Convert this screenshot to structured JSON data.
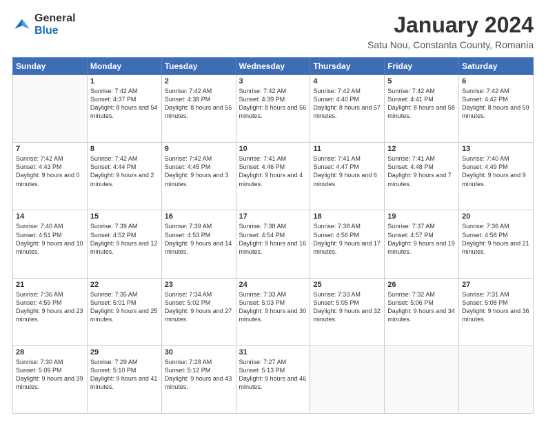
{
  "header": {
    "logo": {
      "general": "General",
      "blue": "Blue"
    },
    "title": "January 2024",
    "location": "Satu Nou, Constanta County, Romania"
  },
  "days_of_week": [
    "Sunday",
    "Monday",
    "Tuesday",
    "Wednesday",
    "Thursday",
    "Friday",
    "Saturday"
  ],
  "weeks": [
    [
      {
        "day": "",
        "text": ""
      },
      {
        "day": "1",
        "text": "Sunrise: 7:42 AM\nSunset: 4:37 PM\nDaylight: 8 hours\nand 54 minutes."
      },
      {
        "day": "2",
        "text": "Sunrise: 7:42 AM\nSunset: 4:38 PM\nDaylight: 8 hours\nand 55 minutes."
      },
      {
        "day": "3",
        "text": "Sunrise: 7:42 AM\nSunset: 4:39 PM\nDaylight: 8 hours\nand 56 minutes."
      },
      {
        "day": "4",
        "text": "Sunrise: 7:42 AM\nSunset: 4:40 PM\nDaylight: 8 hours\nand 57 minutes."
      },
      {
        "day": "5",
        "text": "Sunrise: 7:42 AM\nSunset: 4:41 PM\nDaylight: 8 hours\nand 58 minutes."
      },
      {
        "day": "6",
        "text": "Sunrise: 7:42 AM\nSunset: 4:42 PM\nDaylight: 8 hours\nand 59 minutes."
      }
    ],
    [
      {
        "day": "7",
        "text": "Sunrise: 7:42 AM\nSunset: 4:43 PM\nDaylight: 9 hours\nand 0 minutes."
      },
      {
        "day": "8",
        "text": "Sunrise: 7:42 AM\nSunset: 4:44 PM\nDaylight: 9 hours\nand 2 minutes."
      },
      {
        "day": "9",
        "text": "Sunrise: 7:42 AM\nSunset: 4:45 PM\nDaylight: 9 hours\nand 3 minutes."
      },
      {
        "day": "10",
        "text": "Sunrise: 7:41 AM\nSunset: 4:46 PM\nDaylight: 9 hours\nand 4 minutes."
      },
      {
        "day": "11",
        "text": "Sunrise: 7:41 AM\nSunset: 4:47 PM\nDaylight: 9 hours\nand 6 minutes."
      },
      {
        "day": "12",
        "text": "Sunrise: 7:41 AM\nSunset: 4:48 PM\nDaylight: 9 hours\nand 7 minutes."
      },
      {
        "day": "13",
        "text": "Sunrise: 7:40 AM\nSunset: 4:49 PM\nDaylight: 9 hours\nand 9 minutes."
      }
    ],
    [
      {
        "day": "14",
        "text": "Sunrise: 7:40 AM\nSunset: 4:51 PM\nDaylight: 9 hours\nand 10 minutes."
      },
      {
        "day": "15",
        "text": "Sunrise: 7:39 AM\nSunset: 4:52 PM\nDaylight: 9 hours\nand 12 minutes."
      },
      {
        "day": "16",
        "text": "Sunrise: 7:39 AM\nSunset: 4:53 PM\nDaylight: 9 hours\nand 14 minutes."
      },
      {
        "day": "17",
        "text": "Sunrise: 7:38 AM\nSunset: 4:54 PM\nDaylight: 9 hours\nand 16 minutes."
      },
      {
        "day": "18",
        "text": "Sunrise: 7:38 AM\nSunset: 4:56 PM\nDaylight: 9 hours\nand 17 minutes."
      },
      {
        "day": "19",
        "text": "Sunrise: 7:37 AM\nSunset: 4:57 PM\nDaylight: 9 hours\nand 19 minutes."
      },
      {
        "day": "20",
        "text": "Sunrise: 7:36 AM\nSunset: 4:58 PM\nDaylight: 9 hours\nand 21 minutes."
      }
    ],
    [
      {
        "day": "21",
        "text": "Sunrise: 7:36 AM\nSunset: 4:59 PM\nDaylight: 9 hours\nand 23 minutes."
      },
      {
        "day": "22",
        "text": "Sunrise: 7:35 AM\nSunset: 5:01 PM\nDaylight: 9 hours\nand 25 minutes."
      },
      {
        "day": "23",
        "text": "Sunrise: 7:34 AM\nSunset: 5:02 PM\nDaylight: 9 hours\nand 27 minutes."
      },
      {
        "day": "24",
        "text": "Sunrise: 7:33 AM\nSunset: 5:03 PM\nDaylight: 9 hours\nand 30 minutes."
      },
      {
        "day": "25",
        "text": "Sunrise: 7:33 AM\nSunset: 5:05 PM\nDaylight: 9 hours\nand 32 minutes."
      },
      {
        "day": "26",
        "text": "Sunrise: 7:32 AM\nSunset: 5:06 PM\nDaylight: 9 hours\nand 34 minutes."
      },
      {
        "day": "27",
        "text": "Sunrise: 7:31 AM\nSunset: 5:08 PM\nDaylight: 9 hours\nand 36 minutes."
      }
    ],
    [
      {
        "day": "28",
        "text": "Sunrise: 7:30 AM\nSunset: 5:09 PM\nDaylight: 9 hours\nand 39 minutes."
      },
      {
        "day": "29",
        "text": "Sunrise: 7:29 AM\nSunset: 5:10 PM\nDaylight: 9 hours\nand 41 minutes."
      },
      {
        "day": "30",
        "text": "Sunrise: 7:28 AM\nSunset: 5:12 PM\nDaylight: 9 hours\nand 43 minutes."
      },
      {
        "day": "31",
        "text": "Sunrise: 7:27 AM\nSunset: 5:13 PM\nDaylight: 9 hours\nand 46 minutes."
      },
      {
        "day": "",
        "text": ""
      },
      {
        "day": "",
        "text": ""
      },
      {
        "day": "",
        "text": ""
      }
    ]
  ]
}
